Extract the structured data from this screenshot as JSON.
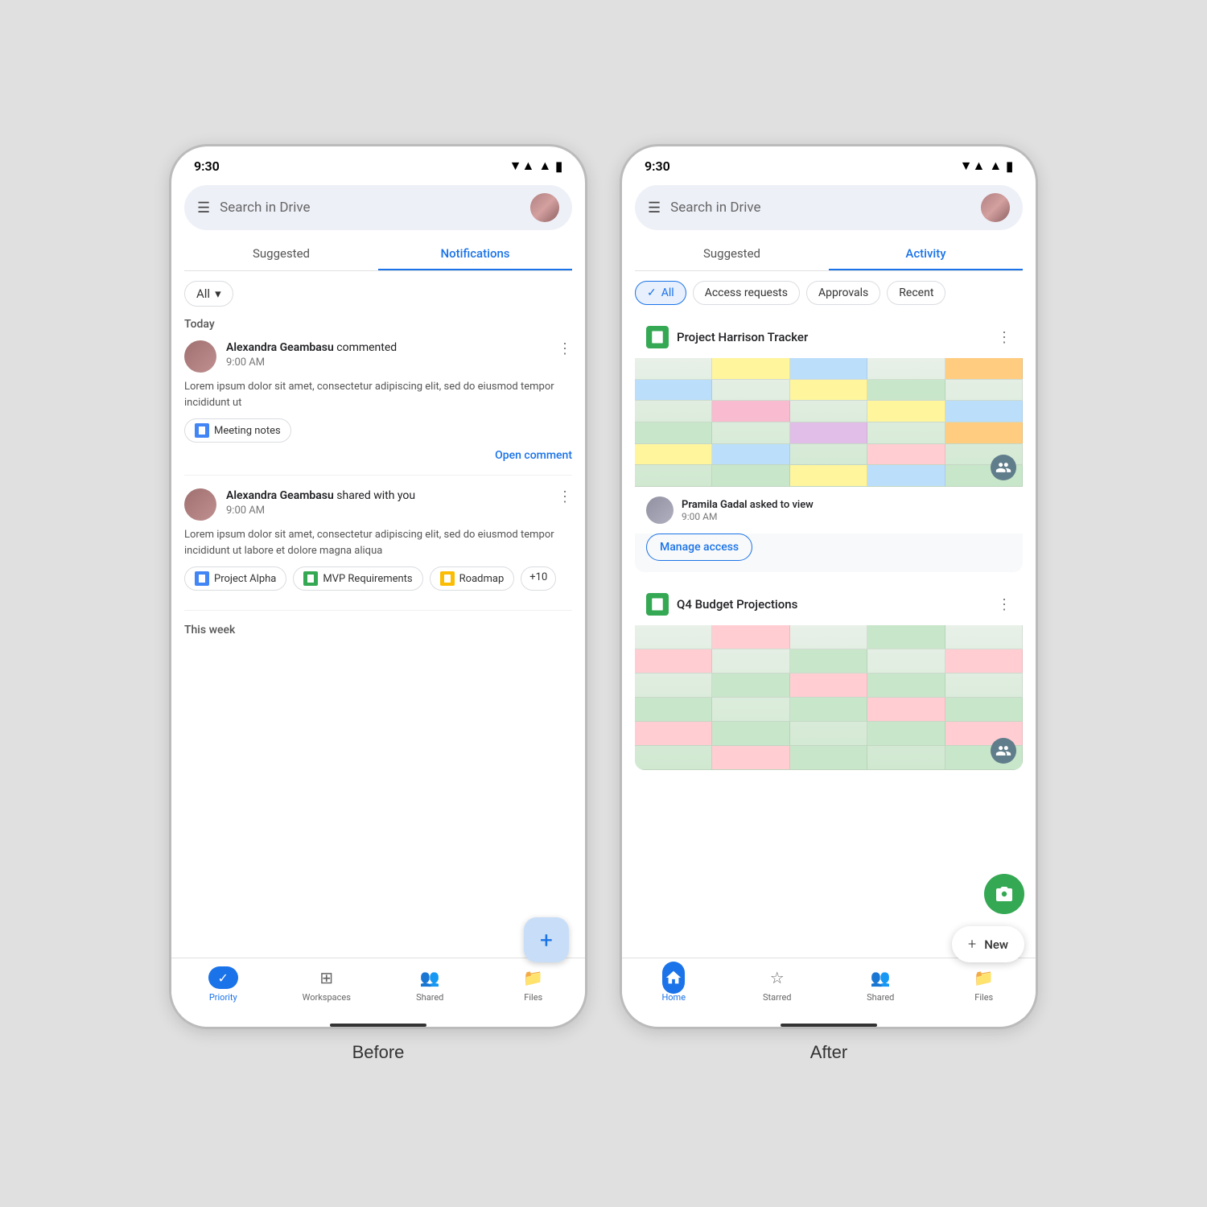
{
  "labels": {
    "before": "Before",
    "after": "After"
  },
  "before_phone": {
    "status_time": "9:30",
    "search_placeholder": "Search in Drive",
    "tabs": [
      "Suggested",
      "Notifications"
    ],
    "active_tab": "Notifications",
    "filter_dropdown": "All",
    "section_today": "Today",
    "section_this_week": "This week",
    "notification1": {
      "user": "Alexandra Geambasu",
      "action": "commented",
      "time": "9:00 AM",
      "body": "Lorem ipsum dolor sit amet, consectetur adipiscing elit, sed do eiusmod tempor incididunt ut",
      "file": "Meeting notes",
      "cta": "Open comment"
    },
    "notification2": {
      "user": "Alexandra Geambasu",
      "action": "shared with you",
      "time": "9:00 AM",
      "body": "Lorem ipsum dolor sit amet, consectetur adipiscing elit, sed do eiusmod tempor incididunt ut labore et dolore magna aliqua",
      "files": [
        "Project Alpha",
        "MVP Requirements",
        "Roadmap"
      ],
      "extra_count": "+10"
    },
    "nav": {
      "items": [
        "Priority",
        "Workspaces",
        "Shared",
        "Files"
      ],
      "active": "Priority"
    }
  },
  "after_phone": {
    "status_time": "9:30",
    "search_placeholder": "Search in Drive",
    "tabs": [
      "Suggested",
      "Activity"
    ],
    "active_tab": "Activity",
    "filters": [
      "All",
      "Access requests",
      "Approvals",
      "Recent"
    ],
    "active_filter": "All",
    "card1": {
      "title": "Project Harrison Tracker",
      "requester": "Pramila Gadal",
      "action": "asked to view",
      "time": "9:00 AM",
      "cta": "Manage access"
    },
    "card2": {
      "title": "Q4 Budget Projections",
      "new_label": "New"
    },
    "nav": {
      "items": [
        "Home",
        "Starred",
        "Shared",
        "Files"
      ],
      "active": "Home"
    }
  }
}
